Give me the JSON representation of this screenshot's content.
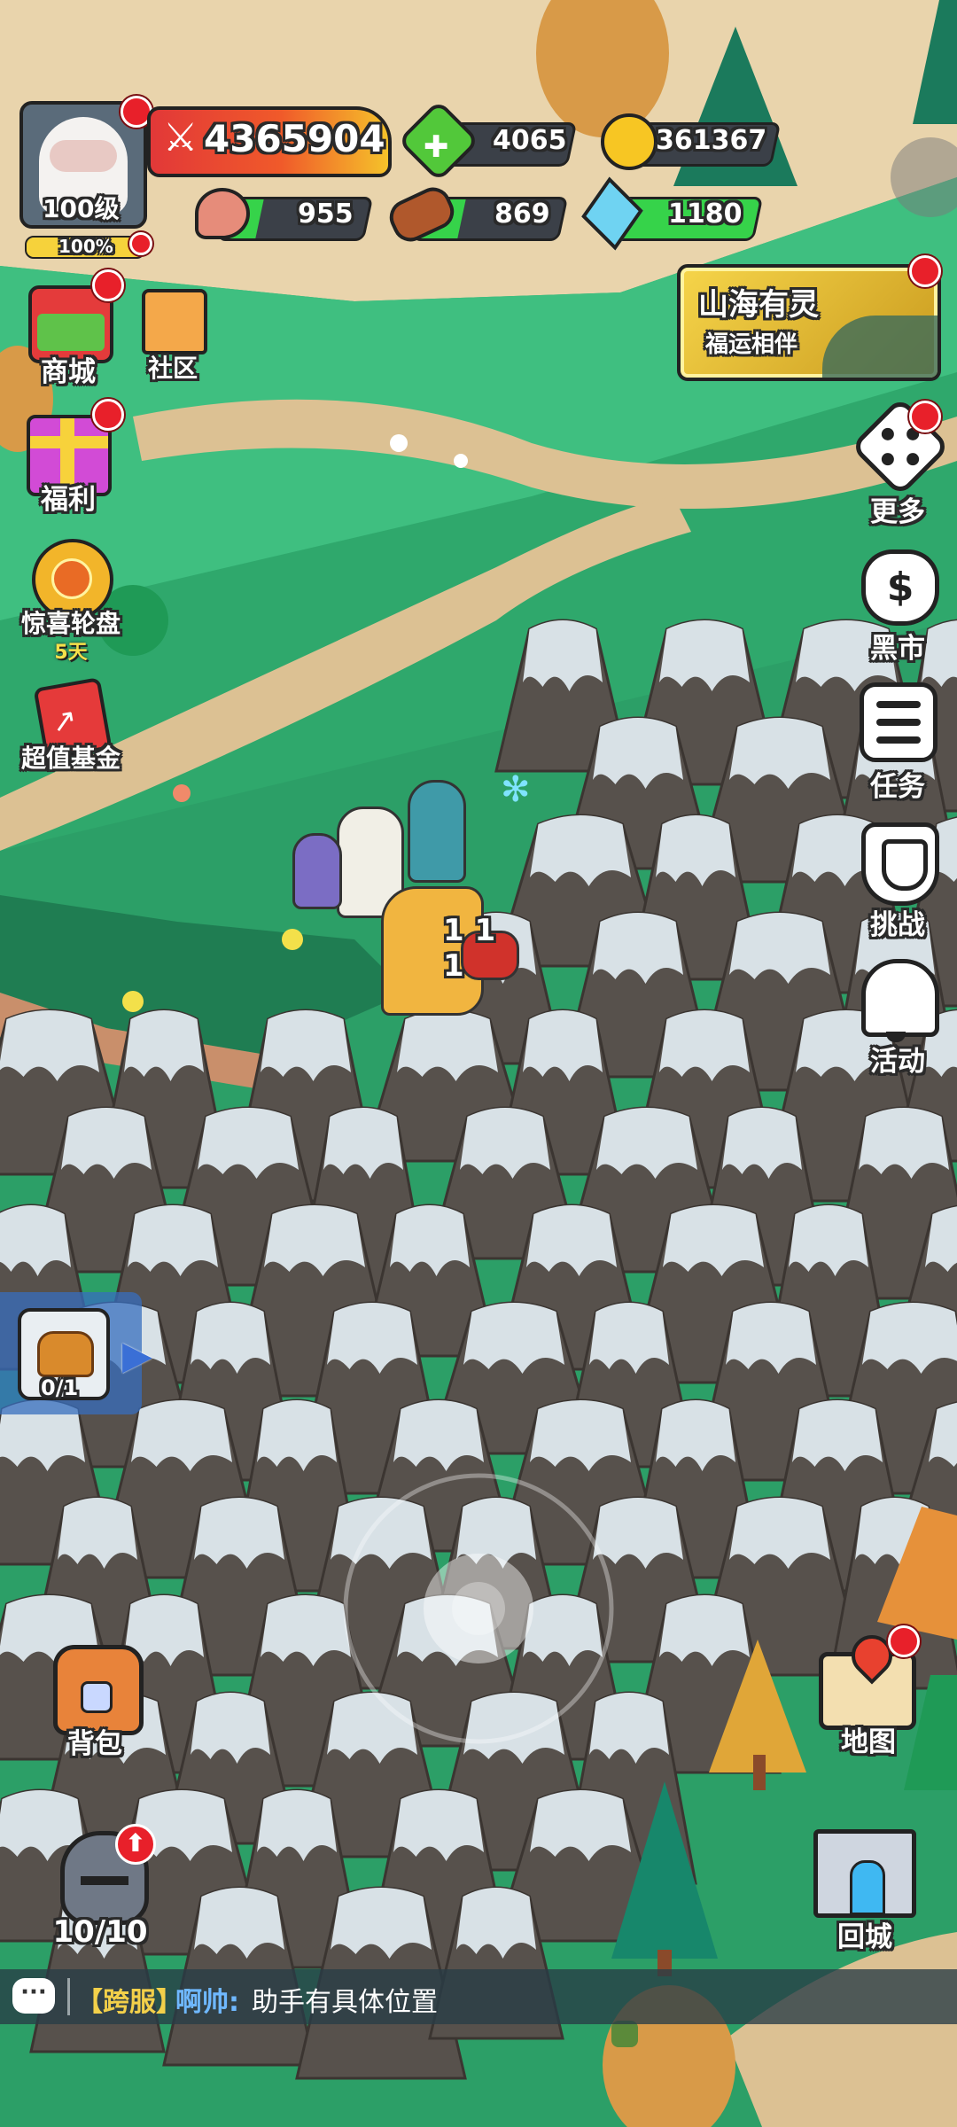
{
  "player": {
    "level": "100级",
    "exp_percent": "100%",
    "exp_fill": 1.0,
    "power": "4365904"
  },
  "resources": {
    "gem": "4065",
    "gold": "361367",
    "meat": "955",
    "wood": "869",
    "crystal": "1180",
    "meat_fill": 0.25,
    "wood_fill": 0.3,
    "crystal_fill": 1.0
  },
  "left_menu": {
    "shop": "商城",
    "community": "社区",
    "welfare": "福利",
    "wheel": "惊喜轮盘",
    "wheel_timer": "5天",
    "fund": "超值基金"
  },
  "event_banner": {
    "title": "山海有灵",
    "subtitle": "福运相伴"
  },
  "right_menu": {
    "more": "更多",
    "black_market": "黑市",
    "tasks": "任务",
    "challenge": "挑战",
    "activity": "活动"
  },
  "quest_tracker": {
    "count": "0/1"
  },
  "bottom": {
    "backpack": "背包",
    "heroes_count": "10/10",
    "map": "地图",
    "return_city": "回城"
  },
  "battle": {
    "damage_text": "1 1 1"
  },
  "chat": {
    "channel": "【跨服】",
    "user": "啊帅:",
    "message": "助手有具体位置"
  },
  "colors": {
    "grass": "#2fa86c",
    "path": "#e2c79a",
    "rock": "#57514c",
    "snow": "#d8e1e6",
    "power_bar": "#e23838",
    "notify": "#e8202a"
  }
}
